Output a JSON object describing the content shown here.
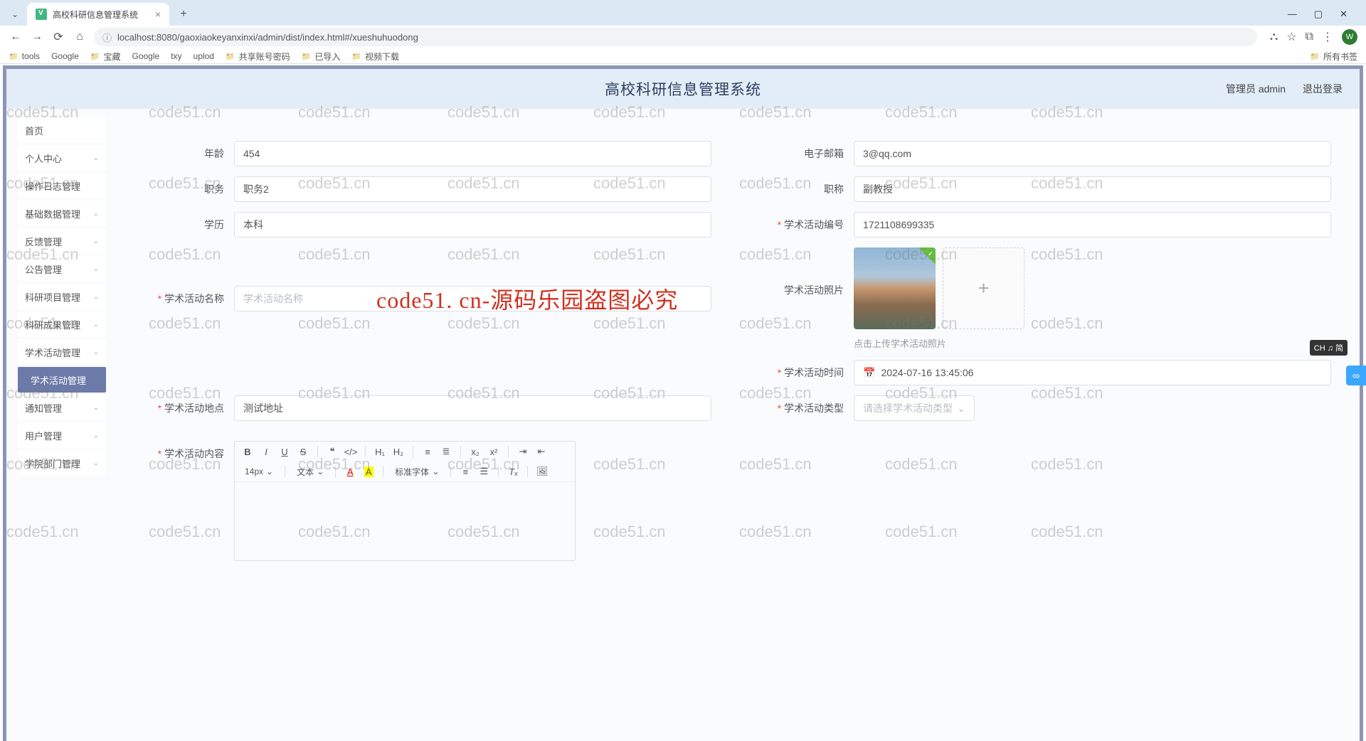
{
  "browser": {
    "tab_title": "高校科研信息管理系统",
    "url": "localhost:8080/gaoxiaokeyanxinxi/admin/dist/index.html#/xueshuhuodong",
    "avatar_letter": "W",
    "bookmarks": [
      "tools",
      "Google",
      "宝藏",
      "Google",
      "txy",
      "uplod",
      "共享账号密码",
      "已导入",
      "视频下载"
    ],
    "bm_right": "所有书签"
  },
  "header": {
    "title": "高校科研信息管理系统",
    "user": "管理员 admin",
    "logout": "退出登录"
  },
  "sidebar": [
    {
      "label": "首页",
      "expandable": false
    },
    {
      "label": "个人中心",
      "expandable": true
    },
    {
      "label": "操作日志管理",
      "expandable": false
    },
    {
      "label": "基础数据管理",
      "expandable": true
    },
    {
      "label": "反馈管理",
      "expandable": true
    },
    {
      "label": "公告管理",
      "expandable": true
    },
    {
      "label": "科研项目管理",
      "expandable": true
    },
    {
      "label": "科研成果管理",
      "expandable": true
    },
    {
      "label": "学术活动管理",
      "expandable": true
    },
    {
      "label": "学术活动管理",
      "expandable": false,
      "active": true
    },
    {
      "label": "通知管理",
      "expandable": true
    },
    {
      "label": "用户管理",
      "expandable": true
    },
    {
      "label": "学院部门管理",
      "expandable": true
    }
  ],
  "form": {
    "age": {
      "label": "年龄",
      "value": "454"
    },
    "email": {
      "label": "电子邮箱",
      "value": "3@qq.com"
    },
    "position": {
      "label": "职务",
      "value": "职务2"
    },
    "title": {
      "label": "职称",
      "value": "副教授"
    },
    "education": {
      "label": "学历",
      "value": "本科"
    },
    "activity_no": {
      "label": "学术活动编号",
      "value": "1721108699335",
      "required": true
    },
    "activity_name": {
      "label": "学术活动名称",
      "placeholder": "学术活动名称",
      "required": true
    },
    "photo_label": "学术活动照片",
    "upload_hint": "点击上传学术活动照片",
    "activity_time": {
      "label": "学术活动时间",
      "value": "2024-07-16 13:45:06",
      "required": true
    },
    "activity_place": {
      "label": "学术活动地点",
      "value": "测试地址",
      "required": true
    },
    "activity_type": {
      "label": "学术活动类型",
      "placeholder": "请选择学术活动类型",
      "required": true
    },
    "activity_content": {
      "label": "学术活动内容",
      "required": true
    }
  },
  "editor": {
    "font_size": "14px",
    "font_family": "标准字体",
    "text_btn": "文本"
  },
  "watermark": {
    "grey": "code51.cn",
    "red": "code51. cn-源码乐园盗图必究"
  },
  "ime": "CH ♫ 简"
}
